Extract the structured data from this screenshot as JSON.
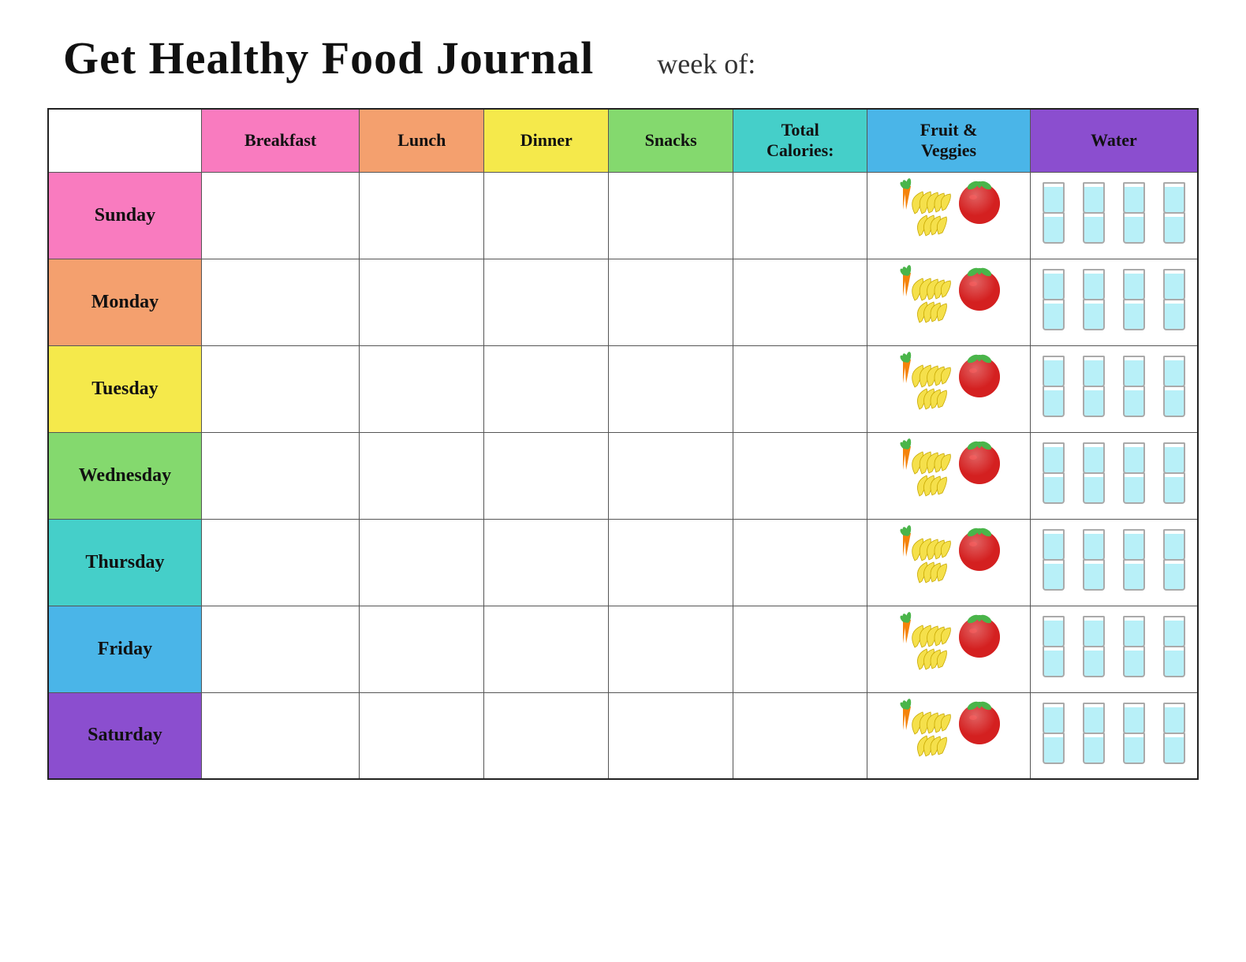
{
  "header": {
    "title": "Get Healthy Food Journal",
    "week_of_label": "week of:"
  },
  "columns": {
    "empty": "",
    "breakfast": "Breakfast",
    "lunch": "Lunch",
    "dinner": "Dinner",
    "snacks": "Snacks",
    "calories": "Total Calories:",
    "fruveggies": "Fruit & Veggies",
    "water": "Water"
  },
  "days": [
    {
      "name": "Sunday",
      "class": "day-sunday"
    },
    {
      "name": "Monday",
      "class": "day-monday"
    },
    {
      "name": "Tuesday",
      "class": "day-tuesday"
    },
    {
      "name": "Wednesday",
      "class": "day-wednesday"
    },
    {
      "name": "Thursday",
      "class": "day-thursday"
    },
    {
      "name": "Friday",
      "class": "day-friday"
    },
    {
      "name": "Saturday",
      "class": "day-saturday"
    }
  ]
}
